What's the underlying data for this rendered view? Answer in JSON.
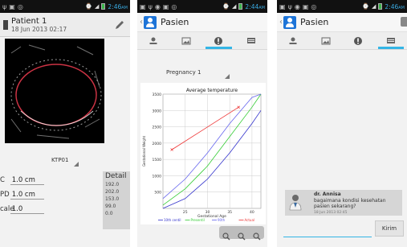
{
  "status_bar": {
    "phone1_time": "2:46",
    "phone1_ampm": "AM",
    "phone2_time": "2:44",
    "phone2_ampm": "AM",
    "phone3_time": "2:46",
    "phone3_ampm": "AM",
    "battery_color": "#3bb54a",
    "time_color": "#39a9e0"
  },
  "phone1": {
    "patient_name": "Patient 1",
    "patient_date": "18 Jun 2013 02:17",
    "scan_label": "KTP01",
    "measurements": [
      {
        "label": "C",
        "value": "1.0 cm"
      },
      {
        "label": "PD",
        "value": "1.0 cm"
      },
      {
        "label": "cale",
        "value": "1.0"
      }
    ],
    "detail": {
      "title": "Detail",
      "rows": [
        "192.0",
        "202.0",
        "153.0",
        "99.0",
        "0.0"
      ]
    }
  },
  "phone2": {
    "app_title": "Pasien",
    "tabs": [
      "tab-person",
      "tab-image",
      "tab-info",
      "tab-list"
    ],
    "active_tab": 2,
    "pregnancy_select": "Pregnancy 1",
    "zoom_icons": [
      "zoom-out-icon",
      "zoom-in-icon",
      "zoom-reset-icon"
    ]
  },
  "phone3": {
    "app_title": "Pasien",
    "active_tab": 3,
    "message": {
      "sender": "dr. Annisa",
      "text": "bagaimana kondisi kesehatan pasien sekarang?",
      "time": "18 Jun 2013 02:45"
    },
    "input_placeholder": "",
    "send_label": "Kirim"
  },
  "chart_data": {
    "type": "line",
    "title": "Average temperature",
    "xlabel": "Gestational Age",
    "ylabel": "Gestational Weight",
    "xlim": [
      20,
      42
    ],
    "ylim": [
      0,
      3500
    ],
    "x_ticks": [
      25,
      30,
      35,
      40
    ],
    "y_ticks": [
      500,
      1000,
      1500,
      2000,
      2500,
      3000,
      3500
    ],
    "x_tick_labels": [
      "25",
      "30",
      "35",
      "40"
    ],
    "y_tick_labels": [
      "500",
      "1000",
      "1500",
      "2000",
      "2500",
      "3000",
      "3500"
    ],
    "grid": true,
    "legend_position": "bottom",
    "series": [
      {
        "name": "10th centil",
        "color": "#3333cc",
        "x": [
          20,
          25,
          30,
          35,
          40,
          42
        ],
        "y": [
          0,
          300,
          900,
          1700,
          2600,
          3000
        ]
      },
      {
        "name": "Presentil",
        "color": "#33cc33",
        "x": [
          20,
          25,
          30,
          35,
          40,
          42
        ],
        "y": [
          100,
          600,
          1300,
          2200,
          3100,
          3500
        ]
      },
      {
        "name": "90th",
        "color": "#6666ee",
        "x": [
          20,
          25,
          30,
          35,
          40,
          42
        ],
        "y": [
          300,
          900,
          1700,
          2600,
          3400,
          3500
        ]
      },
      {
        "name": "Actual",
        "color": "#ee3333",
        "x": [
          22,
          37
        ],
        "y": [
          1800,
          3100
        ]
      }
    ]
  }
}
